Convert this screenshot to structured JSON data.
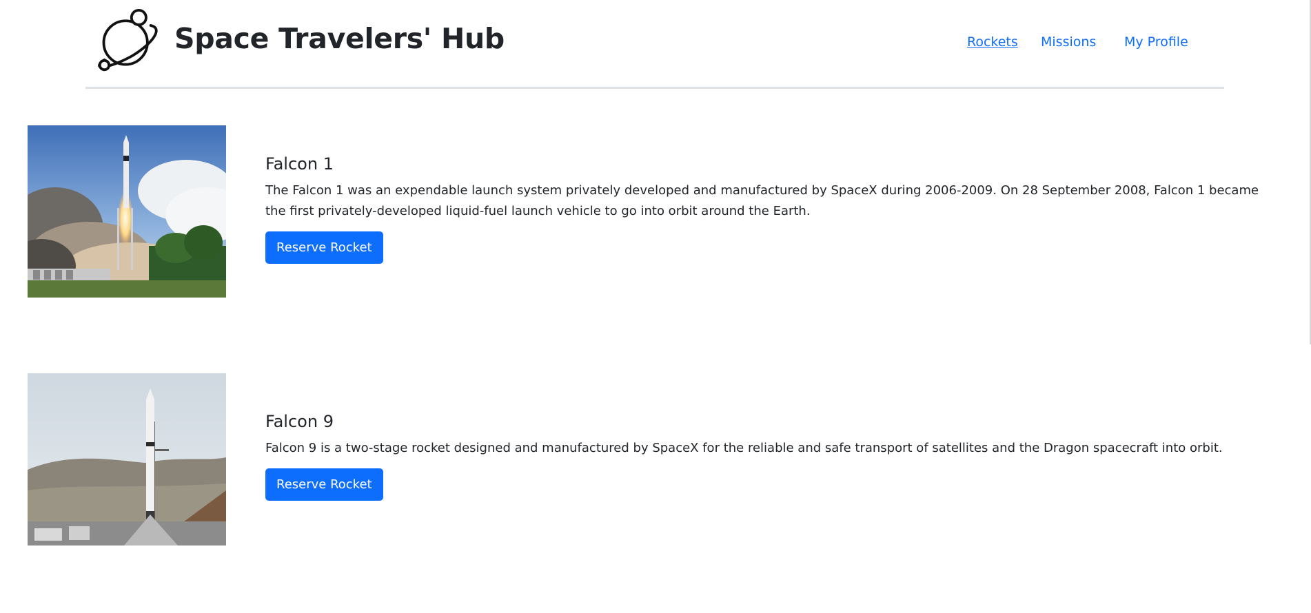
{
  "header": {
    "title": "Space Travelers' Hub",
    "logo_icon": "planet-logo-icon"
  },
  "nav": {
    "items": [
      {
        "label": "Rockets",
        "active": true
      },
      {
        "label": "Missions",
        "active": false
      },
      {
        "label": "My Profile",
        "active": false
      }
    ]
  },
  "rockets": [
    {
      "name": "Falcon 1",
      "description": "The Falcon 1 was an expendable launch system privately developed and manufactured by SpaceX during 2006-2009. On 28 September 2008, Falcon 1 became the first privately-developed liquid-fuel launch vehicle to go into orbit around the Earth.",
      "button_label": "Reserve Rocket",
      "image_icon": "falcon-1-launch-photo"
    },
    {
      "name": "Falcon 9",
      "description": "Falcon 9 is a two-stage rocket designed and manufactured by SpaceX for the reliable and safe transport of satellites and the Dragon spacecraft into orbit.",
      "button_label": "Reserve Rocket",
      "image_icon": "falcon-9-pad-photo"
    }
  ],
  "colors": {
    "link": "#0d6efd",
    "button": "#0d6efd",
    "text": "#212529",
    "divider": "#dee2e6"
  }
}
